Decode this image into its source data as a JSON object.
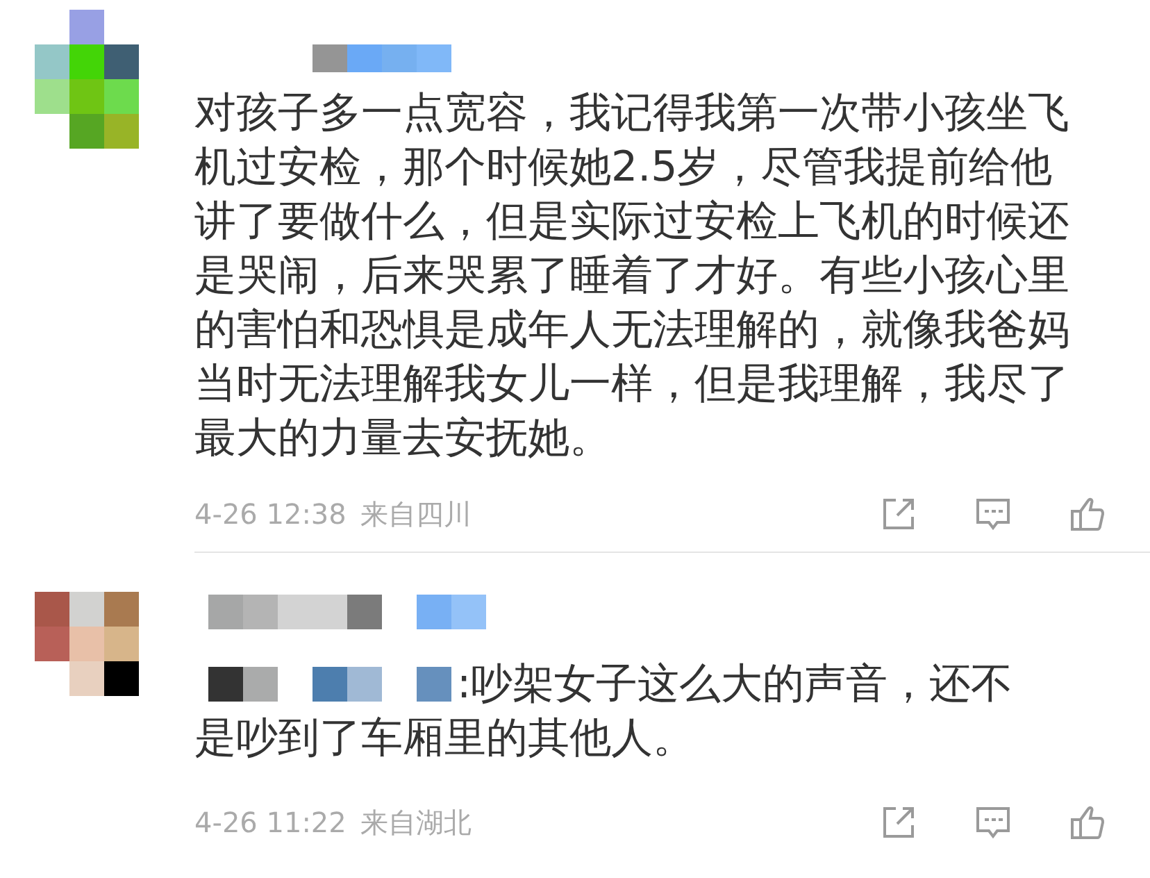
{
  "comments": [
    {
      "lines": [
        "对孩子多一点宽容，我记得我第一次带小孩坐飞",
        "机过安检，那个时候她2.5岁，尽管我提前给他",
        "讲了要做什么，但是实际过安检上飞机的时候还",
        "是哭闹，后来哭累了睡着了才好。有些小孩心里",
        "的害怕和恐惧是成年人无法理解的，就像我爸妈",
        "当时无法理解我女儿一样，但是我理解，我尽了",
        "最大的力量去安抚她。"
      ],
      "time": "4-26 12:38",
      "location": "来自四川",
      "kind": "plain"
    },
    {
      "lines": [
        ":吵架女子这么大的声音，还不",
        "是吵到了车厢里的其他人。"
      ],
      "time": "4-26 11:22",
      "location": "来自湖北",
      "kind": "reply"
    }
  ]
}
